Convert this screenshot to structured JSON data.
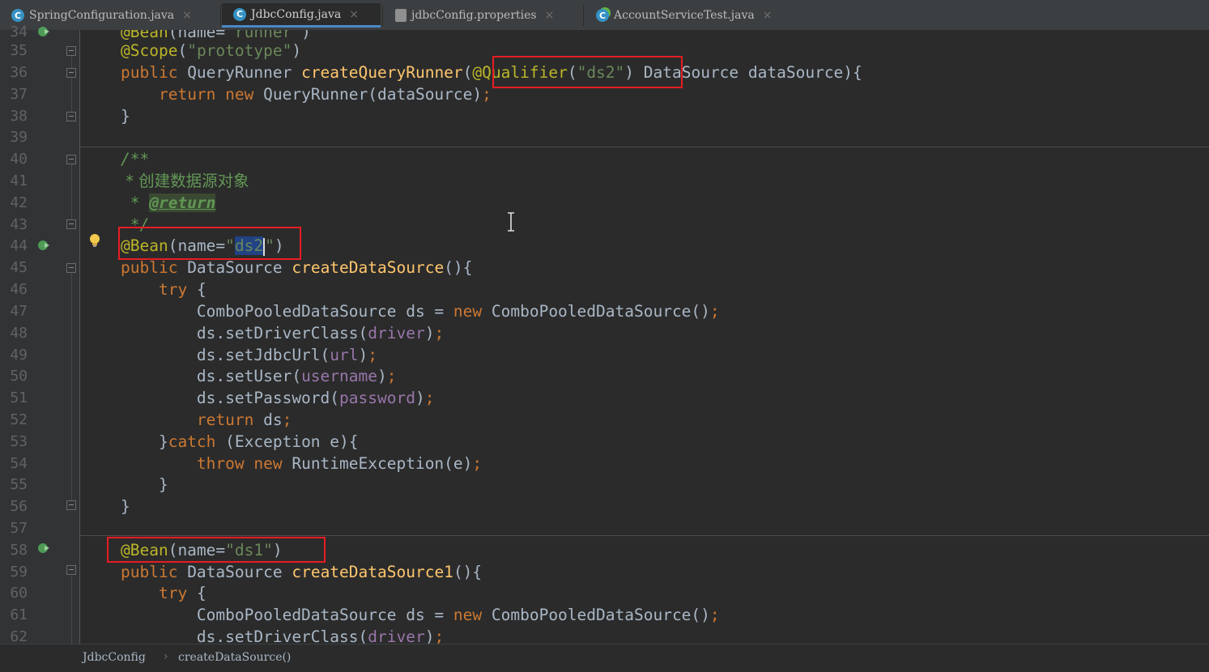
{
  "tabs": [
    {
      "label": "SpringConfiguration.java",
      "icon": "C",
      "active": false
    },
    {
      "label": "JdbcConfig.java",
      "icon": "C",
      "active": true
    },
    {
      "label": "jdbcConfig.properties",
      "icon": "properties-file",
      "active": false
    },
    {
      "label": "AccountServiceTest.java",
      "icon": "C",
      "active": false
    }
  ],
  "tab_close_glyph": "×",
  "editor": {
    "lines": [
      {
        "num": "34",
        "text": "@Bean(name=\"runner\")"
      },
      {
        "num": "35",
        "text": "@Scope(\"prototype\")"
      },
      {
        "num": "36",
        "text": "public QueryRunner createQueryRunner(@Qualifier(\"ds2\") DataSource dataSource){"
      },
      {
        "num": "37",
        "text": "    return new QueryRunner(dataSource);"
      },
      {
        "num": "38",
        "text": "}"
      },
      {
        "num": "39",
        "text": ""
      },
      {
        "num": "40",
        "text": "/**"
      },
      {
        "num": "41",
        "text": " * 创建数据源对象"
      },
      {
        "num": "42",
        "text": " * @return"
      },
      {
        "num": "43",
        "text": " */"
      },
      {
        "num": "44",
        "text": "@Bean(name=\"ds2\")"
      },
      {
        "num": "45",
        "text": "public DataSource createDataSource(){"
      },
      {
        "num": "46",
        "text": "    try {"
      },
      {
        "num": "47",
        "text": "        ComboPooledDataSource ds = new ComboPooledDataSource();"
      },
      {
        "num": "48",
        "text": "        ds.setDriverClass(driver);"
      },
      {
        "num": "49",
        "text": "        ds.setJdbcUrl(url);"
      },
      {
        "num": "50",
        "text": "        ds.setUser(username);"
      },
      {
        "num": "51",
        "text": "        ds.setPassword(password);"
      },
      {
        "num": "52",
        "text": "        return ds;"
      },
      {
        "num": "53",
        "text": "    }catch (Exception e){"
      },
      {
        "num": "54",
        "text": "        throw new RuntimeException(e);"
      },
      {
        "num": "55",
        "text": "    }"
      },
      {
        "num": "56",
        "text": "}"
      },
      {
        "num": "57",
        "text": ""
      },
      {
        "num": "58",
        "text": "@Bean(name=\"ds1\")"
      },
      {
        "num": "59",
        "text": "public DataSource createDataSource1(){"
      },
      {
        "num": "60",
        "text": "    try {"
      },
      {
        "num": "61",
        "text": "        ComboPooledDataSource ds = new ComboPooledDataSource();"
      },
      {
        "num": "62",
        "text": "        ds.setDriverClass(driver);"
      }
    ],
    "highlighted_selection": "ds2"
  },
  "breadcrumb": {
    "items": [
      "JdbcConfig",
      "createDataSource()"
    ],
    "separator": "›"
  },
  "colors": {
    "background": "#2b2b2b",
    "gutter": "#313335",
    "keyword": "#cc7832",
    "annotation": "#bbb529",
    "string": "#6a8759",
    "field": "#9876aa",
    "method": "#ffc66d",
    "comment": "#629755",
    "highlight_box": "#e81c24",
    "active_tab_underline": "#4a88c7"
  },
  "icons": [
    "class-icon",
    "properties-file-icon",
    "test-class-icon",
    "close-icon",
    "bean-gutter-icon",
    "fold-icon",
    "intention-bulb-icon",
    "text-cursor-icon"
  ]
}
